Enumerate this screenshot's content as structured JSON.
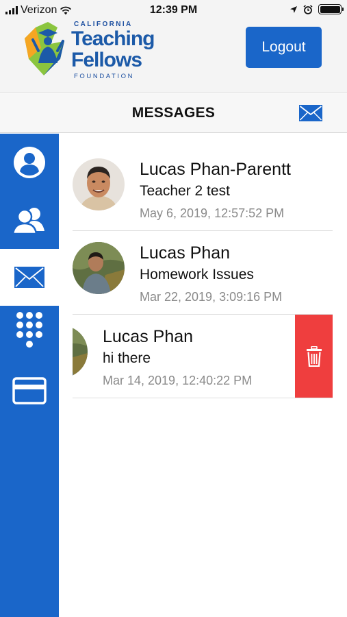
{
  "status_bar": {
    "carrier": "Verizon",
    "time": "12:39 PM"
  },
  "header": {
    "logo": {
      "line1": "CALIFORNIA",
      "line2": "Teaching",
      "line3": "Fellows",
      "line4": "FOUNDATION"
    },
    "logout_label": "Logout"
  },
  "page": {
    "title": "MESSAGES",
    "compose_icon": "envelope-icon"
  },
  "sidebar": {
    "items": [
      {
        "icon": "profile-icon",
        "active": false
      },
      {
        "icon": "group-icon",
        "active": false
      },
      {
        "icon": "envelope-icon",
        "active": true
      },
      {
        "icon": "keypad-icon",
        "active": false
      },
      {
        "icon": "card-icon",
        "active": false
      }
    ]
  },
  "messages": [
    {
      "sender": "Lucas Phan-Parentt",
      "subject": "Teacher 2 test",
      "date": "May 6, 2019, 12:57:52 PM",
      "swiped": false
    },
    {
      "sender": "Lucas Phan",
      "subject": "Homework Issues",
      "date": "Mar 22, 2019, 3:09:16 PM",
      "swiped": false
    },
    {
      "sender": "Lucas Phan",
      "subject": "hi there",
      "date": "Mar 14, 2019, 12:40:22 PM",
      "swiped": true
    }
  ],
  "colors": {
    "primary_blue": "#1a66c9",
    "delete_red": "#ef3e3e",
    "logo_blue": "#1c5aa8",
    "logo_green": "#8bc53f",
    "logo_orange": "#f5a623"
  }
}
